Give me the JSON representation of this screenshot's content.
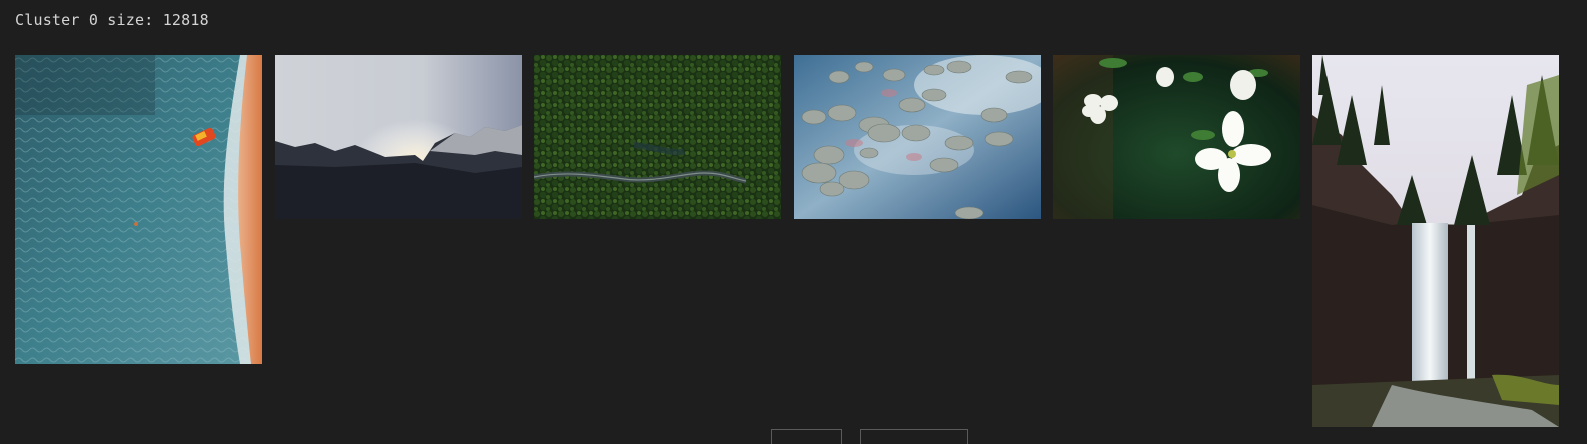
{
  "cluster": {
    "title": "Cluster 0 size: 12818"
  },
  "images": [
    {
      "subject": "aerial-beach-surf-with-boat"
    },
    {
      "subject": "mountain-ridge-at-sunrise"
    },
    {
      "subject": "aerial-forest-with-winding-road"
    },
    {
      "subject": "lily-pads-reflecting-clouds"
    },
    {
      "subject": "white-dogwood-flowers"
    },
    {
      "subject": "waterfall-in-forest-canyon"
    }
  ],
  "colors": {
    "background": "#1e1e1e",
    "title_text": "#d4d4d4"
  }
}
